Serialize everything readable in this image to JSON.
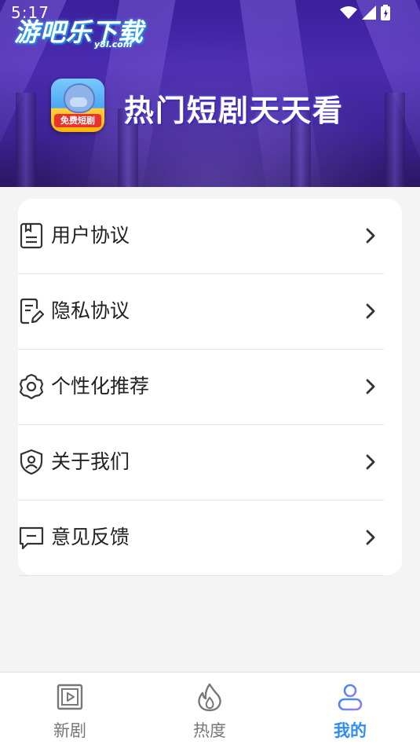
{
  "status_bar": {
    "time": "5:17"
  },
  "watermark": {
    "title": "游吧乐下载",
    "sub": "y8l.com"
  },
  "banner": {
    "app_icon_label": "免费短剧",
    "slogan": "热门短剧天天看"
  },
  "menu": {
    "items": [
      {
        "label": "用户协议",
        "icon": "document-icon"
      },
      {
        "label": "隐私协议",
        "icon": "edit-document-icon"
      },
      {
        "label": "个性化推荐",
        "icon": "gear-icon"
      },
      {
        "label": "关于我们",
        "icon": "shield-user-icon"
      },
      {
        "label": "意见反馈",
        "icon": "message-icon"
      }
    ]
  },
  "bottom_nav": {
    "tabs": [
      {
        "label": "新剧",
        "icon": "play-square-icon",
        "active": false
      },
      {
        "label": "热度",
        "icon": "flame-icon",
        "active": false
      },
      {
        "label": "我的",
        "icon": "user-icon",
        "active": true
      }
    ]
  },
  "colors": {
    "accent": "#2f8df5",
    "text": "#222222",
    "banner": "#3a1f9c"
  }
}
